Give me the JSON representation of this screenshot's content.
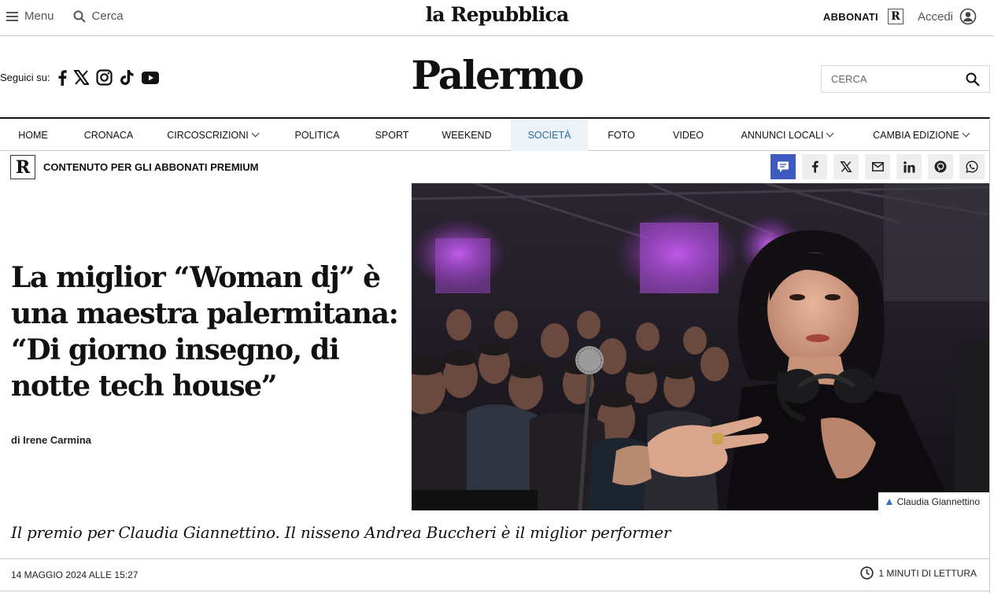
{
  "topbar": {
    "menu_label": "Menu",
    "search_label": "Cerca",
    "logo": "la Repubblica",
    "subscribe_label": "ABBONATI",
    "premium_mark": "R",
    "login_label": "Accedi"
  },
  "header": {
    "follow_label": "Seguici su:",
    "social_icons": [
      "facebook-icon",
      "x-icon",
      "instagram-icon",
      "tiktok-icon",
      "youtube-icon"
    ],
    "section_title": "Palermo",
    "search_placeholder": "CERCA"
  },
  "nav": {
    "items": [
      {
        "label": "HOME"
      },
      {
        "label": "CRONACA"
      },
      {
        "label": "CIRCOSCRIZIONI",
        "dropdown": true
      },
      {
        "label": "POLITICA"
      },
      {
        "label": "SPORT"
      },
      {
        "label": "WEEKEND"
      },
      {
        "label": "SOCIETÀ",
        "active": true
      },
      {
        "label": "FOTO"
      },
      {
        "label": "VIDEO"
      },
      {
        "label": "ANNUNCI LOCALI",
        "dropdown": true
      },
      {
        "label": "CAMBIA EDIZIONE",
        "dropdown": true
      }
    ]
  },
  "premium": {
    "mark": "R",
    "label": "CONTENUTO PER GLI ABBONATI PREMIUM",
    "share_icons": [
      "comment-icon",
      "facebook-icon",
      "x-icon",
      "mail-icon",
      "linkedin-icon",
      "pinterest-icon",
      "whatsapp-icon"
    ]
  },
  "article": {
    "headline": "La miglior “Woman dj” è una maestra palermitana: “Di giorno insegno, di notte tech house”",
    "byline": "di Irene Carmina",
    "photo_credit": "Claudia Giannettino",
    "subtitle": "Il premio per Claudia Giannettino. Il nisseno Andrea Buccheri è il miglior performer",
    "date": "14 MAGGIO 2024 ALLE 15:27",
    "reading_time": "1 MINUTI DI LETTURA"
  },
  "colors": {
    "accent": "#3d5bbf",
    "active_nav_bg": "#ebf3f8",
    "active_nav_text": "#2a6c9e",
    "caption_triangle": "#3d6fb6"
  }
}
